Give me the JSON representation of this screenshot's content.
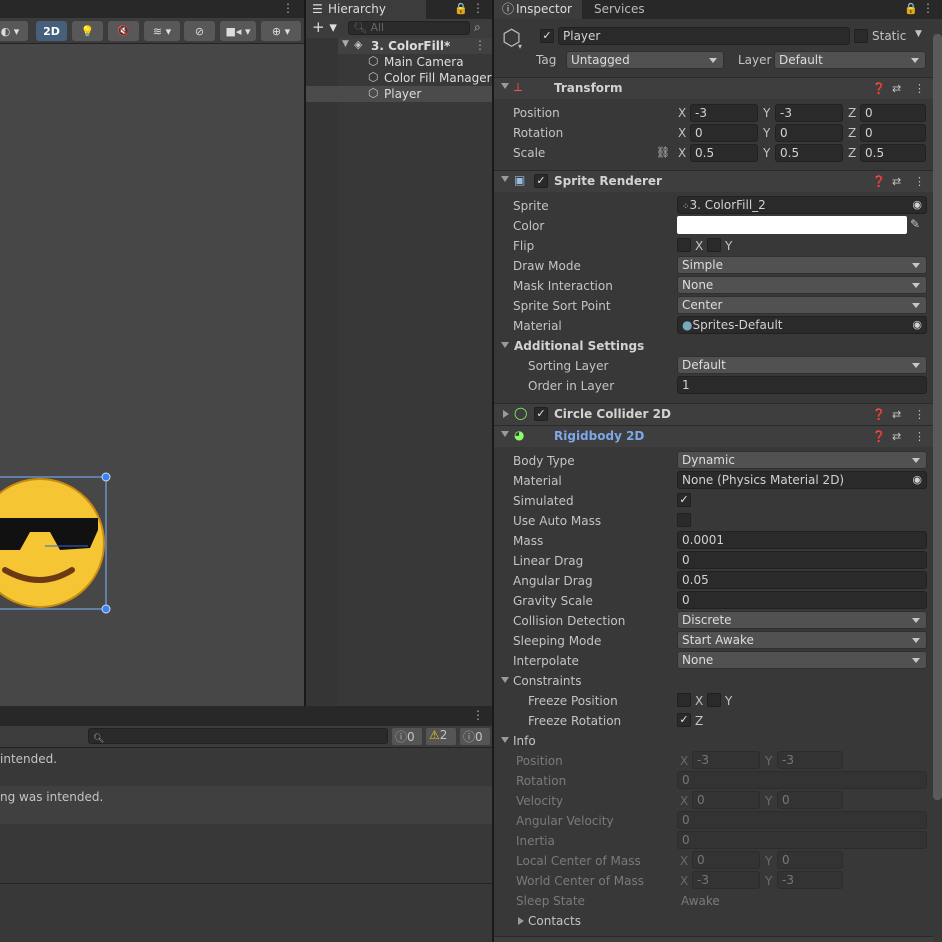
{
  "scene": {
    "toolbar": {
      "mode_2d": "2D"
    }
  },
  "hierarchy": {
    "tab_label": "Hierarchy",
    "search_placeholder": "All",
    "scene_name": "3. ColorFill*",
    "items": [
      "Main Camera",
      "Color Fill Manager",
      "Player"
    ]
  },
  "inspector": {
    "tabs": [
      "Inspector",
      "Services"
    ],
    "object_name": "Player",
    "static_label": "Static",
    "tag_label": "Tag",
    "tag_value": "Untagged",
    "layer_label": "Layer",
    "layer_value": "Default",
    "transform": {
      "title": "Transform",
      "position_label": "Position",
      "rotation_label": "Rotation",
      "scale_label": "Scale",
      "position": [
        "-3",
        "-3",
        "0"
      ],
      "rotation": [
        "0",
        "0",
        "0"
      ],
      "scale": [
        "0.5",
        "0.5",
        "0.5"
      ],
      "axes": [
        "X",
        "Y",
        "Z"
      ]
    },
    "sprite_renderer": {
      "title": "Sprite Renderer",
      "sprite_label": "Sprite",
      "sprite_value": "3. ColorFill_2",
      "color_label": "Color",
      "flip_label": "Flip",
      "flip_x": "X",
      "flip_y": "Y",
      "draw_mode_label": "Draw Mode",
      "draw_mode_value": "Simple",
      "mask_label": "Mask Interaction",
      "mask_value": "None",
      "sort_point_label": "Sprite Sort Point",
      "sort_point_value": "Center",
      "material_label": "Material",
      "material_value": "Sprites-Default",
      "additional_label": "Additional Settings",
      "sorting_layer_label": "Sorting Layer",
      "sorting_layer_value": "Default",
      "order_label": "Order in Layer",
      "order_value": "1"
    },
    "circle_collider": {
      "title": "Circle Collider 2D"
    },
    "rigidbody": {
      "title": "Rigidbody 2D",
      "body_type_label": "Body Type",
      "body_type_value": "Dynamic",
      "material_label": "Material",
      "material_value": "None (Physics Material 2D)",
      "simulated_label": "Simulated",
      "auto_mass_label": "Use Auto Mass",
      "mass_label": "Mass",
      "mass_value": "0.0001",
      "linear_drag_label": "Linear Drag",
      "linear_drag_value": "0",
      "angular_drag_label": "Angular Drag",
      "angular_drag_value": "0.05",
      "gravity_label": "Gravity Scale",
      "gravity_value": "0",
      "collision_label": "Collision Detection",
      "collision_value": "Discrete",
      "sleeping_label": "Sleeping Mode",
      "sleeping_value": "Start Awake",
      "interpolate_label": "Interpolate",
      "interpolate_value": "None",
      "constraints_label": "Constraints",
      "freeze_pos_label": "Freeze Position",
      "freeze_rot_label": "Freeze Rotation",
      "fp_x": "X",
      "fp_y": "Y",
      "fr_z": "Z",
      "info_label": "Info",
      "info": {
        "position_label": "Position",
        "position": [
          "-3",
          "-3"
        ],
        "rotation_label": "Rotation",
        "rotation": "0",
        "velocity_label": "Velocity",
        "velocity": [
          "0",
          "0"
        ],
        "ang_vel_label": "Angular Velocity",
        "ang_vel": "0",
        "inertia_label": "Inertia",
        "inertia": "0",
        "local_com_label": "Local Center of Mass",
        "local_com": [
          "0",
          "0"
        ],
        "world_com_label": "World Center of Mass",
        "world_com": [
          "-3",
          "-3"
        ],
        "sleep_state_label": "Sleep State",
        "sleep_state": "Awake",
        "contacts_label": "Contacts"
      }
    }
  },
  "console": {
    "counts": {
      "info": "0",
      "warn": "2",
      "error": "0"
    },
    "messages": [
      "intended.",
      "ng was intended."
    ]
  }
}
